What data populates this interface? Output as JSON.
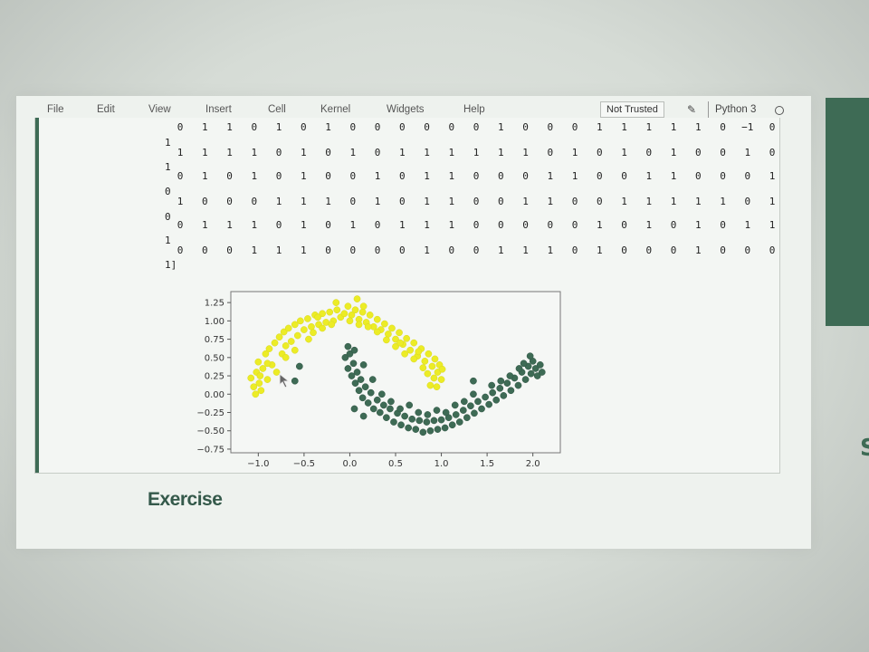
{
  "menu": {
    "items": [
      "File",
      "Edit",
      "View",
      "Insert",
      "Cell",
      "Kernel",
      "Widgets",
      "Help"
    ],
    "trust_label": "Not Trusted",
    "kernel_name": "Python 3"
  },
  "output": {
    "rows": [
      {
        "values": "0 1 1 0 1 0 1 0 0 0 0 0 0 1 0 0 0 1 1 1 1 1 0 −1 0",
        "lead": ""
      },
      {
        "values": "1 1 1 1 0 1 0 1 0 1 1 1 1 1 1 0 1 0 1 0 1 0 0 1 0",
        "lead": "1"
      },
      {
        "values": "0 1 0 1 0 1 0 0 1 0 1 1 0 0 0 1 1 0 0 1 1 0 0 0 1",
        "lead": "1"
      },
      {
        "values": "1 0 0 0 1 1 1 0 1 0 1 1 0 0 1 1 0 0 1 1 1 1 1 0 1",
        "lead": "0"
      },
      {
        "values": "0 1 1 1 0 1 0 1 0 1 1 1 0 0 0 0 0 1 0 1 0 1 0 1 1",
        "lead": "0"
      },
      {
        "values": "0 0 0 1 1 1 0 0 0 0 1 0 0 1 1 1 0 1 0 0 0 1 0 0 0",
        "lead": "1"
      }
    ],
    "closing": "1]"
  },
  "chart_data": {
    "type": "scatter",
    "title": "",
    "xlabel": "",
    "ylabel": "",
    "xlim": [
      -1.3,
      2.3
    ],
    "ylim": [
      -0.8,
      1.4
    ],
    "xticks": [
      "−1.0",
      "−0.5",
      "0.0",
      "0.5",
      "1.0",
      "1.5",
      "2.0"
    ],
    "xtick_values": [
      -1.0,
      -0.5,
      0.0,
      0.5,
      1.0,
      1.5,
      2.0
    ],
    "yticks": [
      "1.25",
      "1.00",
      "0.75",
      "0.50",
      "0.25",
      "0.00",
      "−0.25",
      "−0.50",
      "−0.75"
    ],
    "ytick_values": [
      1.25,
      1.0,
      0.75,
      0.5,
      0.25,
      0.0,
      -0.25,
      -0.5,
      -0.75
    ],
    "series": [
      {
        "color": "#ecec26",
        "points": [
          [
            -1.08,
            0.22
          ],
          [
            -1.05,
            0.1
          ],
          [
            -1.02,
            0.3
          ],
          [
            -1.0,
            0.44
          ],
          [
            -0.97,
            0.05
          ],
          [
            -0.95,
            0.35
          ],
          [
            -0.92,
            0.55
          ],
          [
            -0.9,
            0.2
          ],
          [
            -0.88,
            0.62
          ],
          [
            -0.85,
            0.4
          ],
          [
            -0.82,
            0.7
          ],
          [
            -0.8,
            0.3
          ],
          [
            -0.77,
            0.78
          ],
          [
            -0.74,
            0.55
          ],
          [
            -0.72,
            0.85
          ],
          [
            -0.7,
            0.66
          ],
          [
            -0.67,
            0.9
          ],
          [
            -0.64,
            0.72
          ],
          [
            -0.6,
            0.95
          ],
          [
            -0.57,
            0.8
          ],
          [
            -0.54,
            1.0
          ],
          [
            -0.5,
            0.88
          ],
          [
            -0.46,
            1.03
          ],
          [
            -0.42,
            0.92
          ],
          [
            -0.38,
            1.08
          ],
          [
            -0.34,
            0.95
          ],
          [
            -0.3,
            1.1
          ],
          [
            -0.26,
            0.98
          ],
          [
            -0.22,
            1.12
          ],
          [
            -0.18,
            1.0
          ],
          [
            -0.14,
            1.15
          ],
          [
            -0.1,
            1.05
          ],
          [
            -0.06,
            1.1
          ],
          [
            -0.02,
            1.2
          ],
          [
            0.02,
            1.08
          ],
          [
            0.06,
            1.15
          ],
          [
            0.1,
            1.02
          ],
          [
            0.14,
            1.12
          ],
          [
            0.18,
            0.98
          ],
          [
            0.22,
            1.08
          ],
          [
            0.26,
            0.92
          ],
          [
            0.3,
            1.02
          ],
          [
            0.34,
            0.88
          ],
          [
            0.38,
            0.96
          ],
          [
            0.42,
            0.82
          ],
          [
            0.46,
            0.9
          ],
          [
            0.5,
            0.75
          ],
          [
            0.54,
            0.84
          ],
          [
            0.58,
            0.68
          ],
          [
            0.62,
            0.76
          ],
          [
            0.66,
            0.6
          ],
          [
            0.7,
            0.7
          ],
          [
            0.74,
            0.52
          ],
          [
            0.78,
            0.62
          ],
          [
            0.82,
            0.45
          ],
          [
            0.86,
            0.55
          ],
          [
            0.9,
            0.38
          ],
          [
            0.93,
            0.48
          ],
          [
            0.96,
            0.3
          ],
          [
            0.98,
            0.4
          ],
          [
            1.0,
            0.2
          ],
          [
            1.01,
            0.34
          ],
          [
            0.92,
            0.22
          ],
          [
            0.88,
            0.12
          ],
          [
            0.95,
            0.1
          ],
          [
            0.85,
            0.28
          ],
          [
            -0.6,
            0.6
          ],
          [
            -0.4,
            0.84
          ],
          [
            -0.2,
            0.95
          ],
          [
            0.0,
            1.0
          ],
          [
            0.2,
            0.92
          ],
          [
            0.4,
            0.74
          ],
          [
            0.6,
            0.55
          ],
          [
            0.8,
            0.36
          ],
          [
            -0.7,
            0.5
          ],
          [
            -0.3,
            0.9
          ],
          [
            0.1,
            0.95
          ],
          [
            0.3,
            0.85
          ],
          [
            0.5,
            0.65
          ],
          [
            0.7,
            0.48
          ],
          [
            -0.9,
            0.42
          ],
          [
            -0.98,
            0.25
          ],
          [
            -1.03,
            0.0
          ],
          [
            -0.99,
            0.15
          ],
          [
            -0.45,
            0.75
          ],
          [
            0.55,
            0.7
          ],
          [
            0.75,
            0.58
          ],
          [
            -0.15,
            1.25
          ],
          [
            0.08,
            1.3
          ],
          [
            -0.35,
            1.05
          ],
          [
            0.15,
            1.2
          ]
        ]
      },
      {
        "color": "#3e6b55",
        "points": [
          [
            -0.05,
            0.5
          ],
          [
            -0.02,
            0.35
          ],
          [
            0.0,
            0.55
          ],
          [
            0.02,
            0.25
          ],
          [
            0.04,
            0.42
          ],
          [
            0.06,
            0.15
          ],
          [
            0.08,
            0.3
          ],
          [
            0.1,
            0.05
          ],
          [
            0.12,
            0.2
          ],
          [
            0.14,
            -0.05
          ],
          [
            0.17,
            0.1
          ],
          [
            0.2,
            -0.12
          ],
          [
            0.23,
            0.02
          ],
          [
            0.26,
            -0.2
          ],
          [
            0.3,
            -0.08
          ],
          [
            0.33,
            -0.25
          ],
          [
            0.37,
            -0.15
          ],
          [
            0.4,
            -0.32
          ],
          [
            0.44,
            -0.2
          ],
          [
            0.48,
            -0.38
          ],
          [
            0.52,
            -0.26
          ],
          [
            0.56,
            -0.42
          ],
          [
            0.6,
            -0.3
          ],
          [
            0.64,
            -0.46
          ],
          [
            0.68,
            -0.34
          ],
          [
            0.72,
            -0.48
          ],
          [
            0.76,
            -0.36
          ],
          [
            0.8,
            -0.52
          ],
          [
            0.84,
            -0.38
          ],
          [
            0.88,
            -0.5
          ],
          [
            0.92,
            -0.36
          ],
          [
            0.96,
            -0.48
          ],
          [
            1.0,
            -0.35
          ],
          [
            1.04,
            -0.46
          ],
          [
            1.08,
            -0.32
          ],
          [
            1.12,
            -0.42
          ],
          [
            1.16,
            -0.28
          ],
          [
            1.2,
            -0.38
          ],
          [
            1.24,
            -0.22
          ],
          [
            1.28,
            -0.32
          ],
          [
            1.32,
            -0.16
          ],
          [
            1.36,
            -0.26
          ],
          [
            1.4,
            -0.1
          ],
          [
            1.44,
            -0.2
          ],
          [
            1.48,
            -0.04
          ],
          [
            1.52,
            -0.14
          ],
          [
            1.56,
            0.02
          ],
          [
            1.6,
            -0.08
          ],
          [
            1.64,
            0.08
          ],
          [
            1.68,
            -0.02
          ],
          [
            1.72,
            0.15
          ],
          [
            1.76,
            0.05
          ],
          [
            1.8,
            0.22
          ],
          [
            1.84,
            0.12
          ],
          [
            1.88,
            0.3
          ],
          [
            1.92,
            0.2
          ],
          [
            1.95,
            0.38
          ],
          [
            1.98,
            0.28
          ],
          [
            2.0,
            0.45
          ],
          [
            2.03,
            0.35
          ],
          [
            2.05,
            0.25
          ],
          [
            2.08,
            0.4
          ],
          [
            2.1,
            0.3
          ],
          [
            1.97,
            0.52
          ],
          [
            1.9,
            0.42
          ],
          [
            -0.02,
            0.65
          ],
          [
            0.05,
            0.6
          ],
          [
            0.15,
            0.4
          ],
          [
            0.25,
            0.2
          ],
          [
            0.35,
            0.0
          ],
          [
            0.45,
            -0.1
          ],
          [
            0.55,
            -0.2
          ],
          [
            0.65,
            -0.15
          ],
          [
            0.75,
            -0.25
          ],
          [
            0.85,
            -0.28
          ],
          [
            0.95,
            -0.22
          ],
          [
            1.05,
            -0.25
          ],
          [
            1.15,
            -0.15
          ],
          [
            1.25,
            -0.1
          ],
          [
            1.35,
            0.0
          ],
          [
            1.55,
            0.12
          ],
          [
            1.75,
            0.25
          ],
          [
            1.85,
            0.35
          ],
          [
            1.65,
            0.18
          ],
          [
            -0.55,
            0.38
          ],
          [
            -0.6,
            0.18
          ],
          [
            1.35,
            0.18
          ],
          [
            0.05,
            -0.2
          ],
          [
            0.15,
            -0.3
          ]
        ]
      }
    ]
  },
  "exercise": {
    "title": "Exercise"
  }
}
